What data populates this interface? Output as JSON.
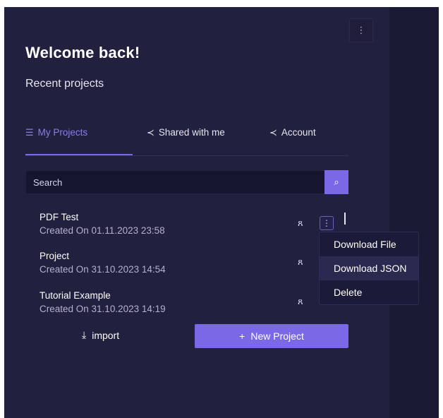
{
  "header": {
    "title": "Welcome back!",
    "subtitle": "Recent projects",
    "top_menu_icon": "⋮"
  },
  "tabs": [
    {
      "label": "My Projects",
      "icon": "☰"
    },
    {
      "label": "Shared with me",
      "icon": "≺"
    },
    {
      "label": "Account",
      "icon": "≺"
    }
  ],
  "search": {
    "placeholder": "Search",
    "icon": "⌕"
  },
  "projects": [
    {
      "name": "PDF Test",
      "created": "Created On 01.11.2023 23:58",
      "user_icon": "ጸ"
    },
    {
      "name": "Project",
      "created": "Created On 31.10.2023 14:54",
      "user_icon": "ጸ"
    },
    {
      "name": "Tutorial Example",
      "created": "Created On 31.10.2023 14:19",
      "user_icon": "ጸ"
    }
  ],
  "row_menu_icon": "⋮",
  "context_menu": {
    "items": [
      "Download File",
      "Download JSON",
      "Delete"
    ]
  },
  "actions": {
    "import_label": "import",
    "import_icon": "⤓",
    "new_project_label": "New Project",
    "new_project_icon": "+"
  },
  "colors": {
    "panel": "#22203f",
    "accent": "#7b68e6"
  }
}
